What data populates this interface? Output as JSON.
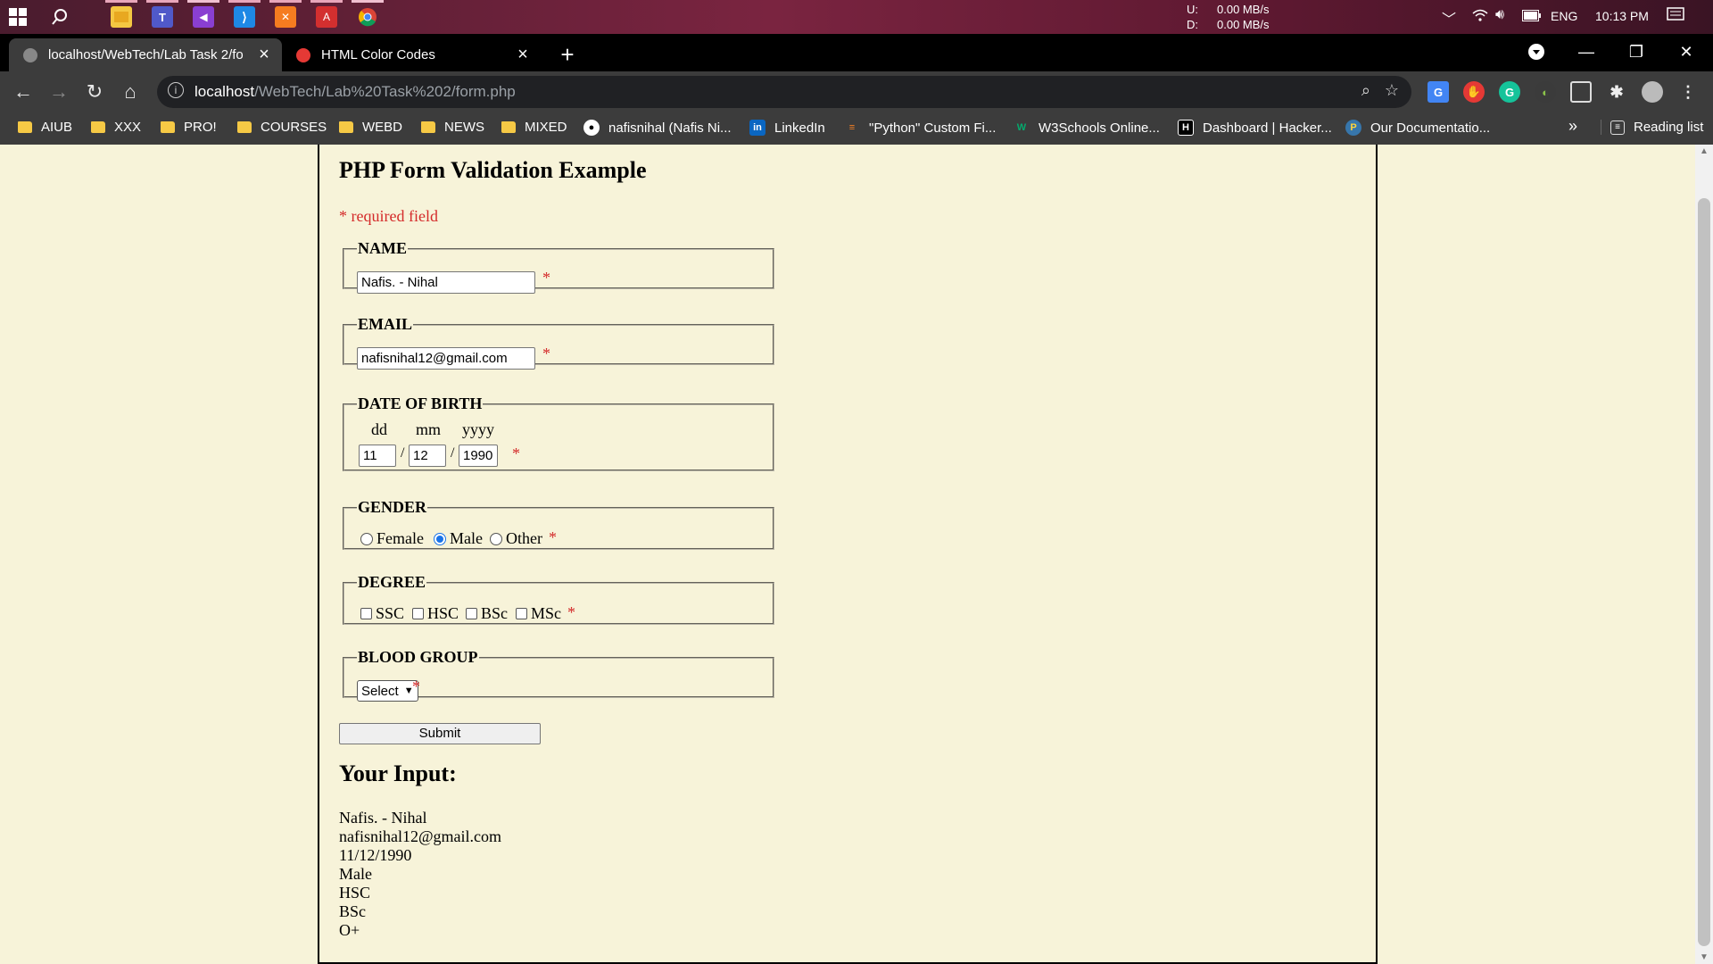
{
  "taskbar": {
    "net_up_label": "U:",
    "net_up_value": "0.00 MB/s",
    "net_down_label": "D:",
    "net_down_value": "0.00 MB/s",
    "language": "ENG",
    "clock": "10:13 PM"
  },
  "browser": {
    "tabs": [
      {
        "title": "localhost/WebTech/Lab Task 2/fo",
        "active": true
      },
      {
        "title": "HTML Color Codes",
        "active": false
      }
    ],
    "url_host": "localhost",
    "url_path": "/WebTech/Lab%20Task%202/form.php",
    "bookmarks": [
      {
        "label": "AIUB",
        "type": "folder"
      },
      {
        "label": "XXX",
        "type": "folder"
      },
      {
        "label": "PRO!",
        "type": "folder"
      },
      {
        "label": "COURSES",
        "type": "folder"
      },
      {
        "label": "WEBD",
        "type": "folder"
      },
      {
        "label": "NEWS",
        "type": "folder"
      },
      {
        "label": "MIXED",
        "type": "folder"
      },
      {
        "label": "nafisnihal (Nafis Ni...",
        "type": "github"
      },
      {
        "label": "LinkedIn",
        "type": "linkedin"
      },
      {
        "label": "\"Python\" Custom Fi...",
        "type": "stackoverflow"
      },
      {
        "label": "W3Schools Online...",
        "type": "w3schools"
      },
      {
        "label": "Dashboard | Hacker...",
        "type": "hackerrank"
      },
      {
        "label": "Our Documentatio...",
        "type": "python"
      }
    ],
    "reading_list": "Reading list",
    "more_bookmarks": "»"
  },
  "form": {
    "heading": "PHP Form Validation Example",
    "required_note": "* required field",
    "required_mark": "*",
    "name_legend": "NAME",
    "name_value": "Nafis. - Nihal",
    "email_legend": "EMAIL",
    "email_value": "nafisnihal12@gmail.com",
    "dob_legend": "DATE OF BIRTH",
    "dob_labels": {
      "dd": "dd",
      "mm": "mm",
      "yyyy": "yyyy"
    },
    "dob_values": {
      "dd": "11",
      "mm": "12",
      "yyyy": "1990"
    },
    "dob_separator": "/",
    "gender_legend": "GENDER",
    "gender_options": [
      "Female",
      "Male",
      "Other"
    ],
    "gender_selected": "Male",
    "degree_legend": "DEGREE",
    "degree_options": [
      "SSC",
      "HSC",
      "BSc",
      "MSc"
    ],
    "blood_legend": "BLOOD GROUP",
    "blood_selected": "Select",
    "submit_label": "Submit"
  },
  "result": {
    "heading": "Your Input:",
    "lines": [
      "Nafis. - Nihal",
      "nafisnihal12@gmail.com",
      "11/12/1990",
      "Male",
      "HSC",
      "BSc",
      "O+"
    ]
  },
  "colors": {
    "page_background": "#f7f3d9",
    "required_red": "#d42a2a",
    "browser_dark": "#3c3c3c",
    "taskbar_accent": "#7a2440"
  }
}
